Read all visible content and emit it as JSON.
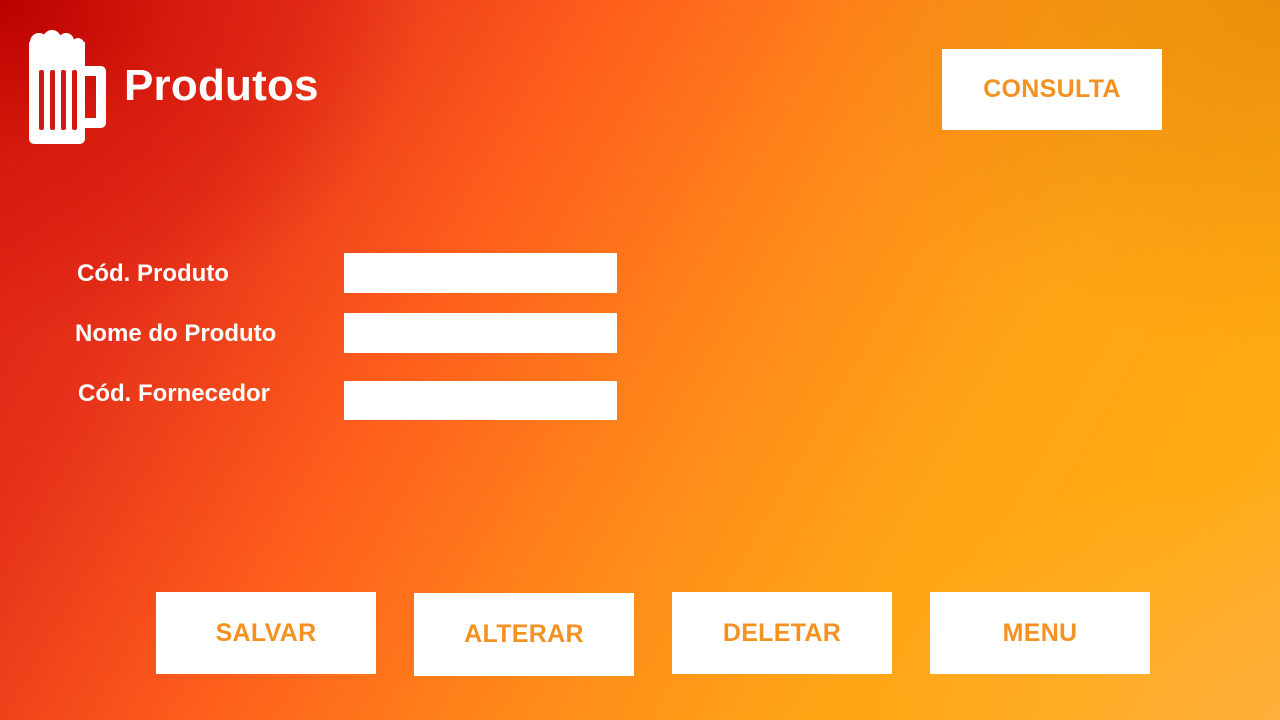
{
  "header": {
    "title": "Produtos",
    "logo_icon": "beer-mug-icon"
  },
  "consulta_button": "CONSULTA",
  "form": {
    "cod_produto": {
      "label": "Cód. Produto",
      "value": "",
      "placeholder": ""
    },
    "nome_produto": {
      "label": "Nome do Produto",
      "value": "",
      "placeholder": ""
    },
    "cod_fornecedor": {
      "label": "Cód. Fornecedor",
      "value": "",
      "placeholder": ""
    }
  },
  "actions": {
    "salvar": "SALVAR",
    "alterar": "ALTERAR",
    "deletar": "DELETAR",
    "menu": "MENU"
  },
  "colors": {
    "button_text": "#f39220",
    "gradient_start": "#c00000",
    "gradient_end": "#ffae2a"
  }
}
